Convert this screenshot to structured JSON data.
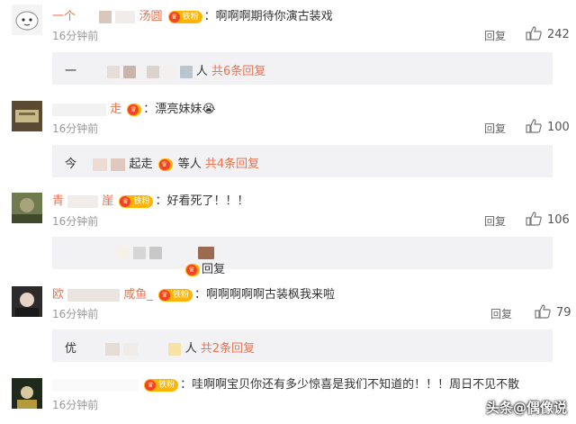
{
  "comments": [
    {
      "name_prefix": "一个",
      "name_suffix": "汤圆",
      "fan_badge": "铁粉",
      "text": "啊啊啊期待你演古装戏",
      "time": "16分钟前",
      "reply": "回复",
      "likes": "242",
      "sub": {
        "prefix": "一",
        "suffix": "人",
        "more": "共6条回复"
      }
    },
    {
      "name_suffix": "走",
      "text": "漂亮妹妹",
      "emoji": "😭",
      "time": "16分钟前",
      "reply": "回复",
      "likes": "100",
      "sub": {
        "prefix": "今",
        "suffix": "起走",
        "middle": "等人",
        "more": "共4条回复"
      }
    },
    {
      "name_prefix": "青",
      "name_suffix": "崖",
      "fan_badge": "铁粉",
      "text": "好看死了！！！",
      "time": "16分钟前",
      "reply": "回复",
      "likes": "106",
      "sub": {
        "suffix": "回复"
      }
    },
    {
      "name_prefix": "欧",
      "name_suffix": "咸鱼_",
      "fan_badge": "铁粉",
      "text": "啊啊啊啊啊古装枫我来啦",
      "time": "16分钟前",
      "reply": "回复",
      "likes": "79",
      "sub": {
        "prefix": "优",
        "suffix": "人",
        "more": "共2条回复"
      }
    },
    {
      "fan_badge": "铁粉",
      "text": "哇啊啊宝贝你还有多少惊喜是我们不知道的！！！周日不见不散",
      "time": "16分钟前"
    }
  ],
  "watermark": "头条@偶像说",
  "colors": {
    "accent": "#eb7350",
    "badge": "#ffb400",
    "subbox": "#f2f2f5",
    "meta": "#999999"
  }
}
